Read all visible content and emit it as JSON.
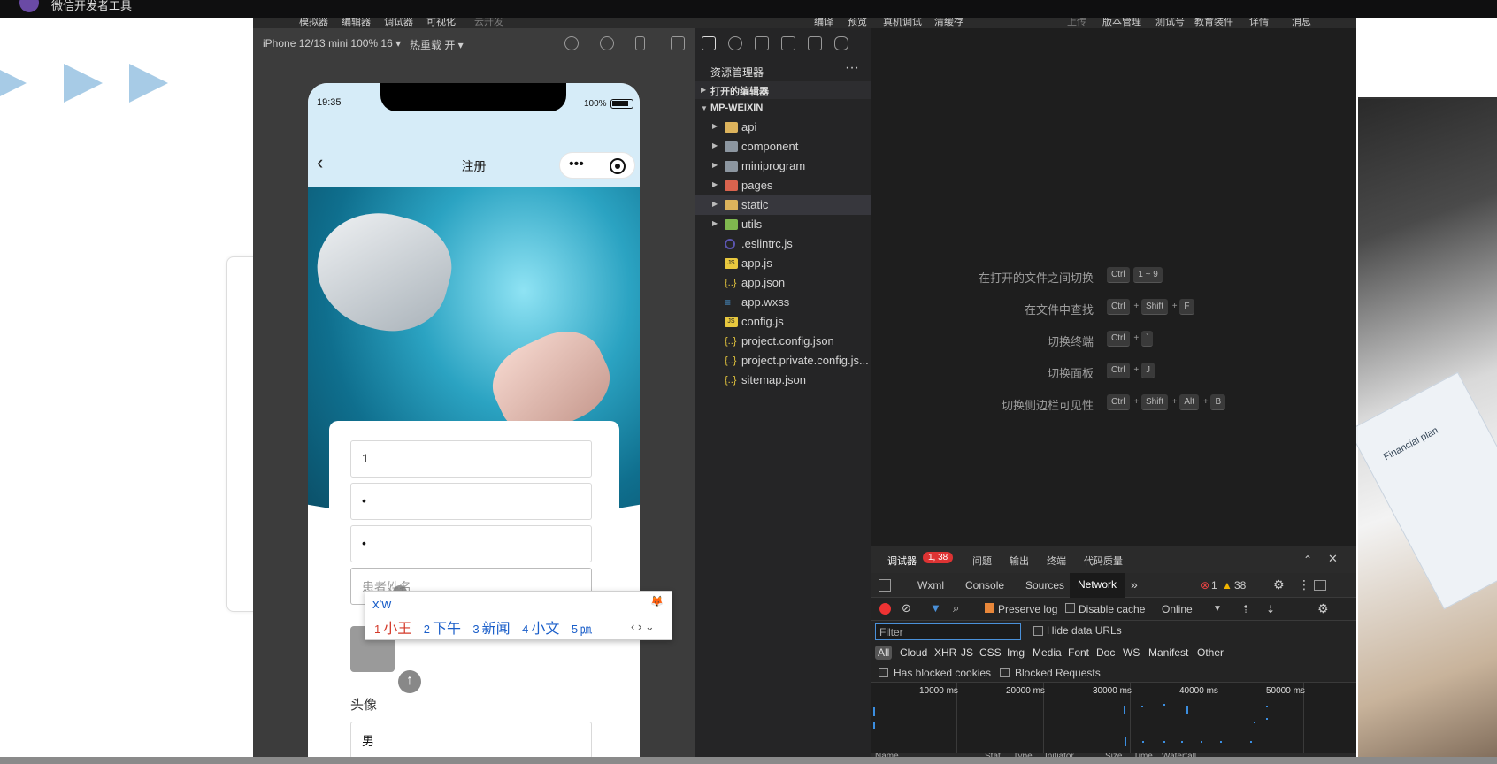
{
  "window": {
    "title": "微信开发者工具"
  },
  "menubar": {
    "items": [
      "模拟器",
      "编辑器",
      "调试器",
      "可视化",
      "云开发"
    ],
    "right_items": [
      "编译",
      "预览",
      "真机调试",
      "清缓存"
    ],
    "far_right": [
      "上传",
      "版本管理",
      "测试号",
      "教育装件",
      "详情",
      "消息"
    ]
  },
  "simulator": {
    "device": "iPhone 12/13 mini 100% 16 ▾",
    "hot_reload": "热重载 开 ▾",
    "status": {
      "time": "19:35",
      "battery": "100%"
    },
    "nav_title": "注册",
    "back": "‹",
    "form": {
      "field1": "1",
      "field2": "•",
      "field3": "•",
      "name_placeholder": "患者姓名",
      "avatar_label": "头像",
      "gender": "男"
    },
    "ime": {
      "composition": "x'w",
      "candidates": [
        {
          "n": "1",
          "t": "小王"
        },
        {
          "n": "2",
          "t": "下午"
        },
        {
          "n": "3",
          "t": "新闻"
        },
        {
          "n": "4",
          "t": "小文"
        },
        {
          "n": "5",
          "t": "㏘"
        }
      ],
      "nav": "‹ › ⌄"
    }
  },
  "explorer": {
    "title": "资源管理器",
    "section_open": "打开的编辑器",
    "section_project": "MP-WEIXIN",
    "files": [
      {
        "name": "api",
        "type": "folder"
      },
      {
        "name": "component",
        "type": "folder"
      },
      {
        "name": "miniprogram",
        "type": "folder"
      },
      {
        "name": "pages",
        "type": "folder"
      },
      {
        "name": "static",
        "type": "folder"
      },
      {
        "name": "utils",
        "type": "folder"
      },
      {
        "name": ".eslintrc.js",
        "type": "eslint"
      },
      {
        "name": "app.js",
        "type": "js"
      },
      {
        "name": "app.json",
        "type": "json"
      },
      {
        "name": "app.wxss",
        "type": "css"
      },
      {
        "name": "config.js",
        "type": "js"
      },
      {
        "name": "project.config.json",
        "type": "json"
      },
      {
        "name": "project.private.config.js...",
        "type": "json"
      },
      {
        "name": "sitemap.json",
        "type": "json"
      }
    ]
  },
  "editor": {
    "shortcuts": [
      {
        "label": "在打开的文件之间切换",
        "keys": [
          "Ctrl",
          "1 ~ 9"
        ]
      },
      {
        "label": "在文件中查找",
        "keys": [
          "Ctrl",
          "+",
          "Shift",
          "+",
          "F"
        ]
      },
      {
        "label": "切换终端",
        "keys": [
          "Ctrl",
          "+",
          "`"
        ]
      },
      {
        "label": "切换面板",
        "keys": [
          "Ctrl",
          "+",
          "J"
        ]
      },
      {
        "label": "切换侧边栏可见性",
        "keys": [
          "Ctrl",
          "+",
          "Shift",
          "+",
          "Alt",
          "+",
          "B"
        ]
      }
    ]
  },
  "devtools": {
    "tabs": [
      "调试器",
      "问题",
      "输出",
      "终端",
      "代码质量"
    ],
    "badge": "1, 38",
    "subtabs": [
      "Wxml",
      "Console",
      "Sources",
      "Network"
    ],
    "more": "»",
    "errors": "1",
    "warnings": "38",
    "preserve_log": "Preserve log",
    "disable_cache": "Disable cache",
    "throttle": "Online",
    "filter_placeholder": "Filter",
    "hide_data_urls": "Hide data URLs",
    "types": [
      "All",
      "Cloud",
      "XHR",
      "JS",
      "CSS",
      "Img",
      "Media",
      "Font",
      "Doc",
      "WS",
      "Manifest",
      "Other"
    ],
    "has_blocked_cookies": "Has blocked cookies",
    "blocked_requests": "Blocked Requests",
    "timeline_ticks": [
      "10000 ms",
      "20000 ms",
      "30000 ms",
      "40000 ms",
      "50000 ms"
    ],
    "columns": [
      "Name",
      "Stat",
      "Type",
      "Initiator",
      "Size",
      "Time",
      "Waterfall"
    ]
  },
  "background": {
    "paper_text": "Financial plan"
  }
}
